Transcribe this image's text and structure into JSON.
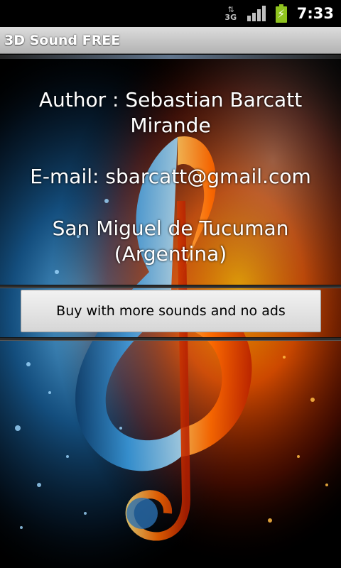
{
  "status_bar": {
    "network_label": "3G",
    "network_arrows": "⇅",
    "battery_glyph": "⚡",
    "time": "7:33"
  },
  "app": {
    "title": "3D Sound FREE"
  },
  "info": {
    "author_line1": "Author : Sebastian Barcatt",
    "author_line2": "Mirande",
    "email": "E-mail: sbarcatt@gmail.com",
    "location_line1": "San Miguel de Tucuman",
    "location_line2": "(Argentina)"
  },
  "buy_button": {
    "label": "Buy with more sounds and no ads"
  },
  "colors": {
    "battery": "#8fc31f",
    "fire": "#ff6a00",
    "water": "#2a8fd4"
  }
}
